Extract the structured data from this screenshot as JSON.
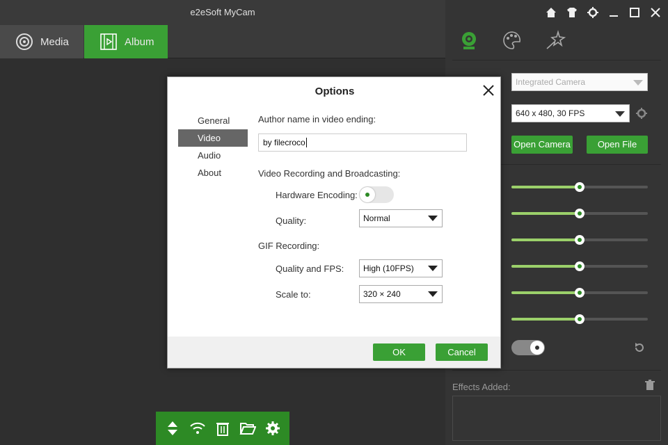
{
  "app": {
    "title": "e2eSoft MyCam"
  },
  "tabs": {
    "media": "Media",
    "album": "Album"
  },
  "window_controls": [
    "home-icon",
    "shirt-icon",
    "gear-icon",
    "minimize-icon",
    "maximize-icon",
    "close-icon"
  ],
  "right_panel": {
    "tabs": [
      "webcam-icon",
      "palette-icon",
      "effects-star-icon"
    ],
    "camera_select": "Integrated Camera",
    "resolution_select": "640 x 480, 30 FPS",
    "open_camera": "Open Camera",
    "open_file": "Open File",
    "sliders": [
      0.5,
      0.5,
      0.5,
      0.5,
      0.5,
      0.5
    ],
    "effects_added": "Effects Added:"
  },
  "dialog": {
    "title": "Options",
    "nav": [
      "General",
      "Video",
      "Audio",
      "About"
    ],
    "selected_nav": "Video",
    "author_label": "Author name in video ending:",
    "author_value": "by filecroco",
    "section_video": "Video Recording and Broadcasting:",
    "hardware_label": "Hardware Encoding:",
    "hardware_on": false,
    "quality_label": "Quality:",
    "quality_value": "Normal",
    "section_gif": "GIF Recording:",
    "gif_quality_label": "Quality and FPS:",
    "gif_quality_value": "High (10FPS)",
    "scale_label": "Scale to:",
    "scale_value": "320 × 240",
    "ok": "OK",
    "cancel": "Cancel"
  },
  "colors": {
    "accent": "#3aa035",
    "dark_green": "#2d8a25",
    "slider_fill": "#9bd06a"
  }
}
